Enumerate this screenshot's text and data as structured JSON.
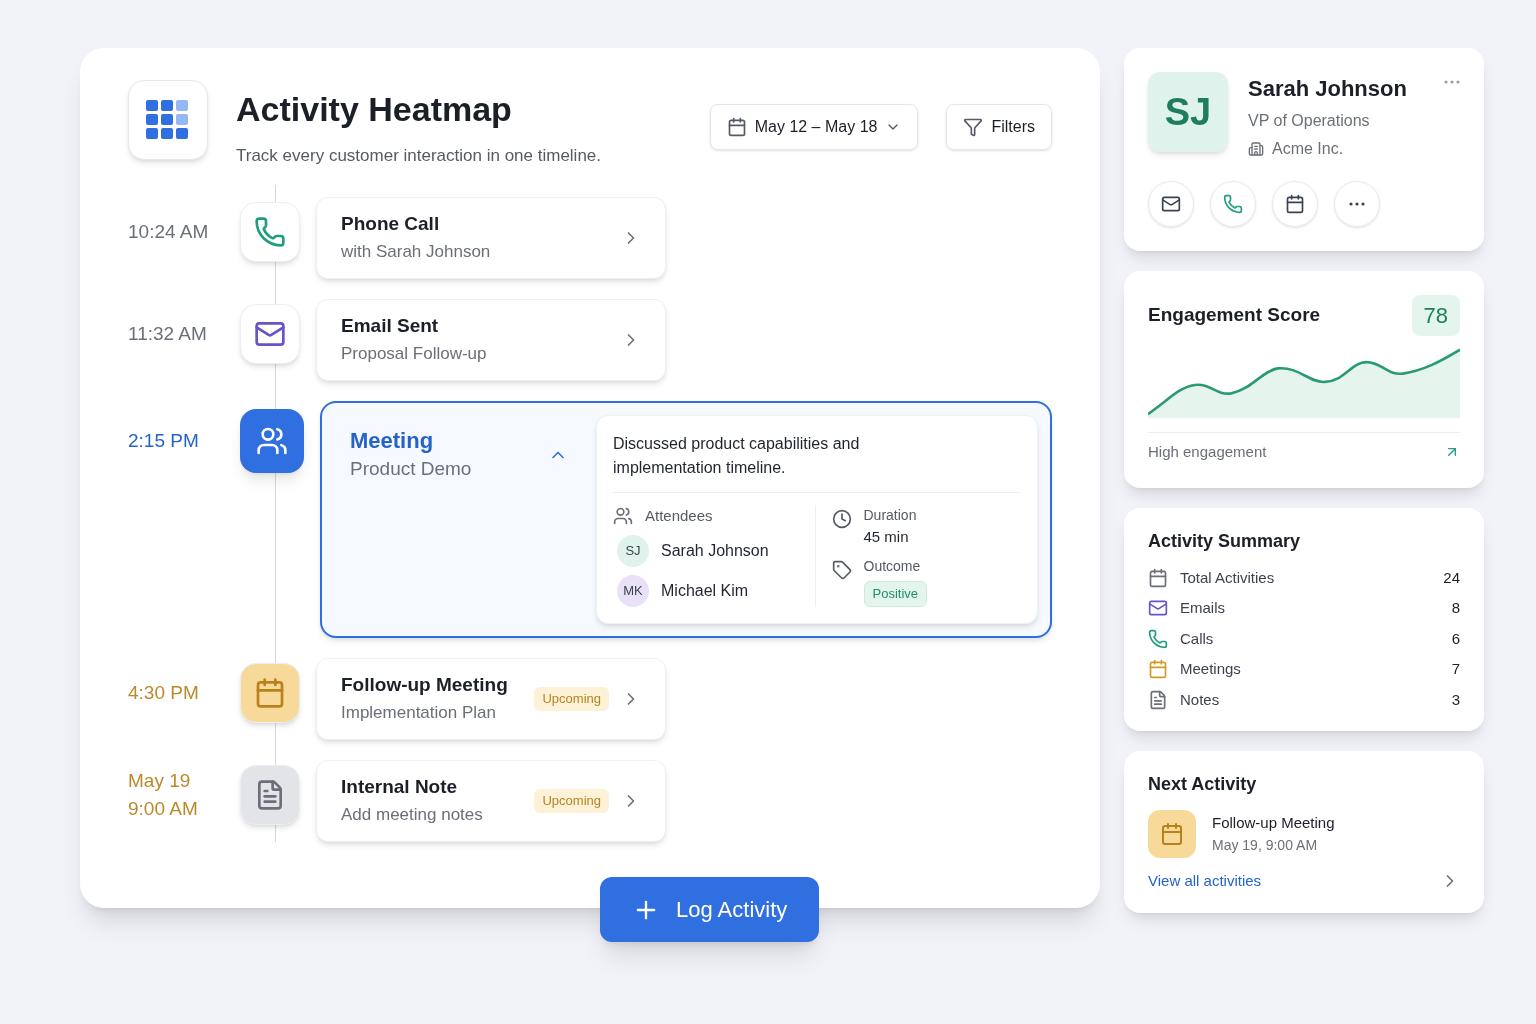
{
  "header": {
    "title": "Activity Heatmap",
    "subtitle": "Track every customer interaction in one timeline.",
    "date_range": "May 12 – May 18",
    "filters": "Filters"
  },
  "timeline": [
    {
      "kind": "call",
      "time": [
        "10:24 AM"
      ],
      "title": "Phone Call",
      "subtitle": "with Sarah Johnson",
      "selected": false,
      "expanded": false
    },
    {
      "kind": "email",
      "time": [
        "11:32 AM"
      ],
      "title": "Email Sent",
      "subtitle": "Proposal Follow-up",
      "selected": false,
      "expanded": false
    },
    {
      "kind": "meeting",
      "time": [
        "2:15 PM"
      ],
      "title": "Meeting",
      "subtitle": "Product Demo",
      "selected": true,
      "expanded": true
    },
    {
      "kind": "meeting",
      "time": [
        "4:30 PM"
      ],
      "title": "Follow-up Meeting",
      "subtitle": "Implementation Plan",
      "badge": "Upcoming",
      "selected": false,
      "expanded": false
    },
    {
      "kind": "note",
      "time": [
        "May 19",
        "9:00 AM"
      ],
      "title": "Internal Note",
      "subtitle": "Add meeting notes",
      "badge": "Upcoming",
      "selected": false,
      "expanded": false
    }
  ],
  "details": {
    "summary": "Discussed product capabilities and implementation timeline.",
    "attendees_label": "Attendees",
    "attendees": [
      {
        "initials": "SJ",
        "name": "Sarah Johnson",
        "color": "#dff3ec"
      },
      {
        "initials": "MK",
        "name": "Michael Kim",
        "color": "#e9e1f8"
      }
    ],
    "duration_label": "Duration",
    "duration": "45 min",
    "outcome_label": "Outcome",
    "outcome": "Positive"
  },
  "log_button": "Log Activity",
  "profile": {
    "initials": "SJ",
    "name": "Sarah Johnson",
    "role": "VP of Operations",
    "company": "Acme Inc.",
    "actions": [
      {
        "kind": "email"
      },
      {
        "kind": "call"
      },
      {
        "kind": "calendar"
      },
      {
        "kind": "more"
      }
    ]
  },
  "engagement": {
    "title": "Engagement Score",
    "score": "78",
    "caption": "High engagement"
  },
  "summary": {
    "title": "Activity Summary",
    "items": [
      {
        "kind": "total",
        "label": "Total Activities",
        "count": "24"
      },
      {
        "kind": "email",
        "label": "Emails",
        "count": "8"
      },
      {
        "kind": "call",
        "label": "Calls",
        "count": "6"
      },
      {
        "kind": "meeting",
        "label": "Meetings",
        "count": "7"
      },
      {
        "kind": "note",
        "label": "Notes",
        "count": "3"
      }
    ]
  },
  "next_activity": {
    "title": "Next Activity",
    "name": "Follow-up Meeting",
    "when": "May 19, 9:00 AM",
    "link": "View all activities"
  }
}
